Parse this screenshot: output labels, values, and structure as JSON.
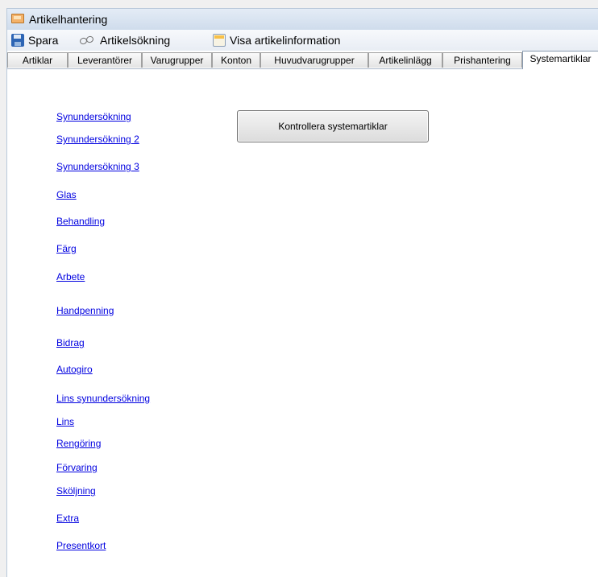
{
  "window": {
    "title": "Artikelhantering"
  },
  "toolbar": {
    "save_label": "Spara",
    "search_label": "Artikelsökning",
    "info_label": "Visa artikelinformation"
  },
  "tabs": [
    {
      "label": "Artiklar"
    },
    {
      "label": "Leverantörer"
    },
    {
      "label": "Varugrupper"
    },
    {
      "label": "Konton"
    },
    {
      "label": "Huvudvarugrupper"
    },
    {
      "label": "Artikelinlägg"
    },
    {
      "label": "Prishantering"
    },
    {
      "label": "Systemartiklar",
      "active": true
    }
  ],
  "links": [
    "Synundersökning",
    "Synundersökning 2",
    "Synundersökning 3",
    "Glas",
    "Behandling",
    "Färg",
    "Arbete",
    "Handpenning",
    "Bidrag",
    "Autogiro",
    "Lins synundersökning",
    "Lins",
    "Rengöring",
    "Förvaring",
    "Sköljning",
    "Extra",
    "Presentkort"
  ],
  "check_button_label": "Kontrollera systemartiklar",
  "colors": {
    "link": "#0000e0",
    "titlebar": "#dbe5f1"
  }
}
